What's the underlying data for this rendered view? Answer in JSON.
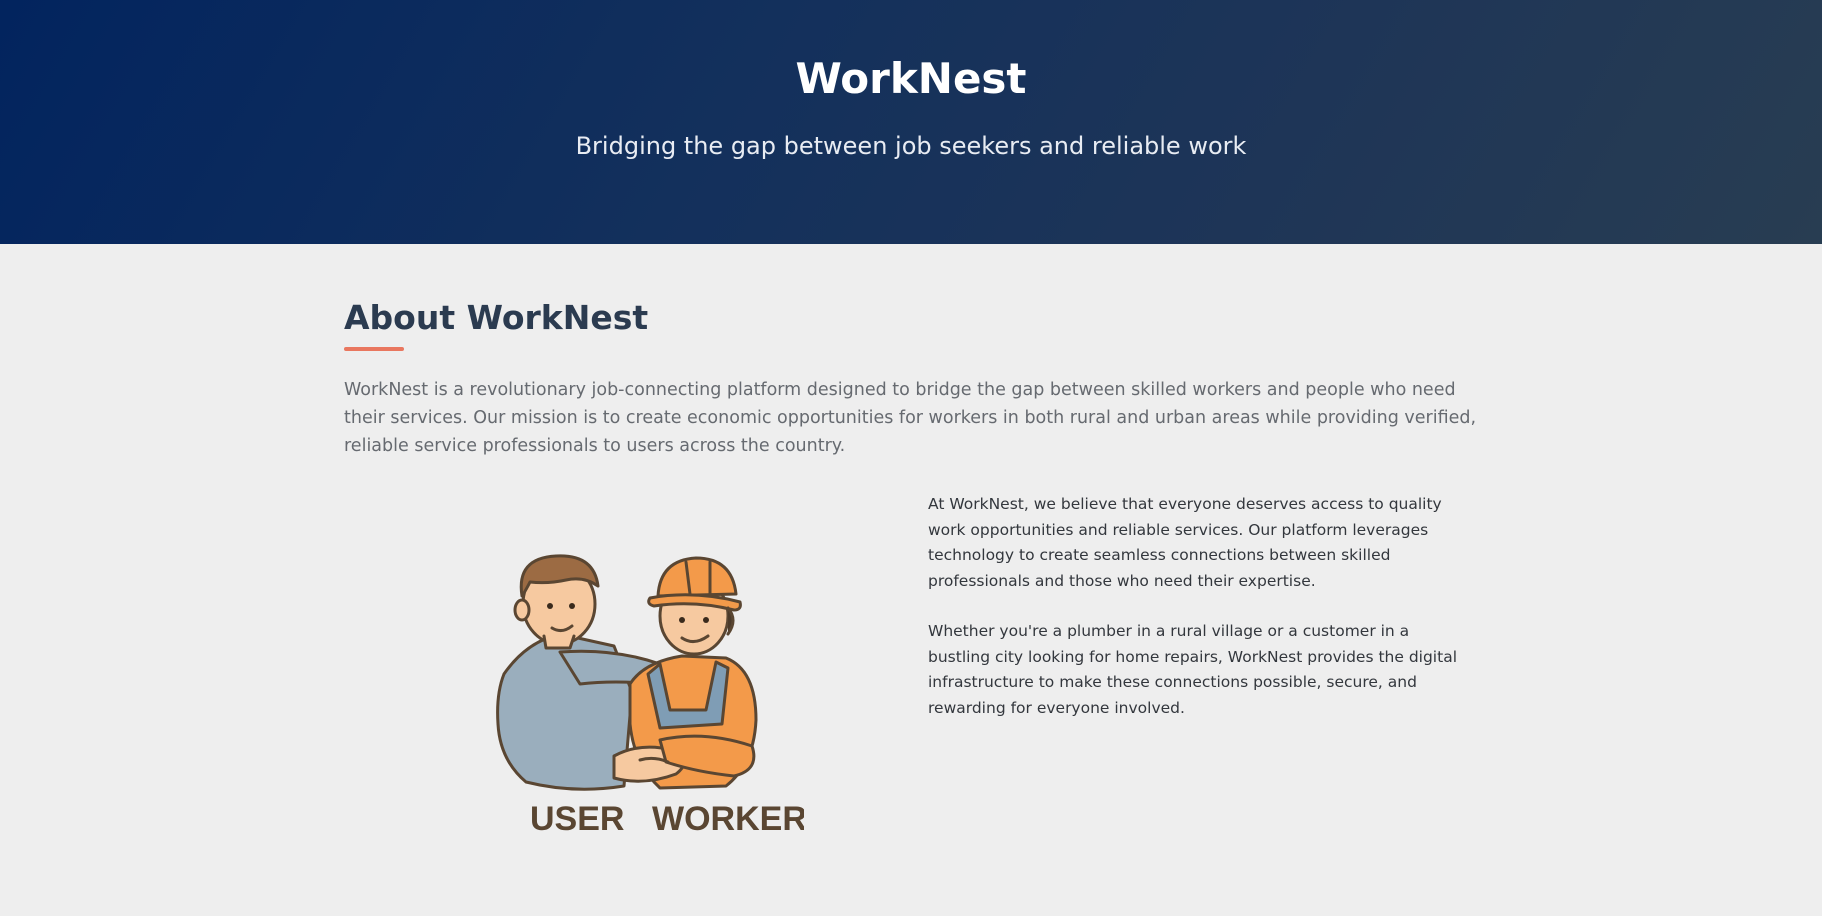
{
  "hero": {
    "title": "WorkNest",
    "subtitle": "Bridging the gap between job seekers and reliable work"
  },
  "about": {
    "heading": "About WorkNest",
    "intro": "WorkNest is a revolutionary job-connecting platform designed to bridge the gap between skilled workers and people who need their services. Our mission is to create economic opportunities for workers in both rural and urban areas while providing verified, reliable service professionals to users across the country.",
    "paragraphs": [
      "At WorkNest, we believe that everyone deserves access to quality work opportunities and reliable services. Our platform leverages technology to create seamless connections between skilled professionals and those who need their expertise.",
      "Whether you're a plumber in a rural village or a customer in a bustling city looking for home repairs, WorkNest provides the digital infrastructure to make these connections possible, secure, and rewarding for everyone involved."
    ],
    "illustration": {
      "left_label": "USER",
      "right_label": "WORKER"
    }
  },
  "colors": {
    "hero_start": "#02245e",
    "hero_end": "#283d52",
    "heading": "#2b3b50",
    "accent": "#e9775f",
    "background": "#eeeeee"
  }
}
